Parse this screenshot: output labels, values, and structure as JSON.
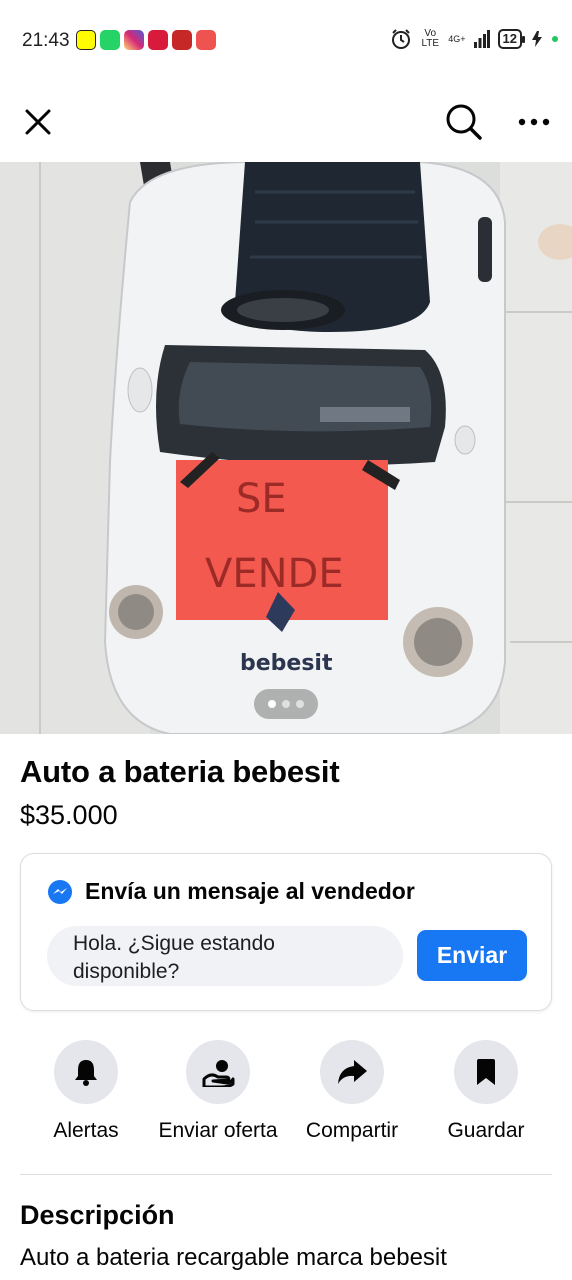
{
  "status_bar": {
    "time": "21:43",
    "notification_icons": [
      "snapchat-icon",
      "whatsapp-icon",
      "instagram-icon",
      "heart-app-icon",
      "shopping-s-icon",
      "gift-app-icon"
    ],
    "volte": "Vo LTE",
    "network": "4G+",
    "battery": "12",
    "accent_colors": {
      "snapchat": "#fffc00",
      "whatsapp": "#25d366",
      "instagram": "#d62976",
      "heart_app": "#d81b3c",
      "shopping": "#c62828",
      "gift_app": "#ef5350"
    }
  },
  "app_bar": {
    "close_icon": "close-icon",
    "search_icon": "search-icon",
    "more_icon": "more-horizontal-icon"
  },
  "photo": {
    "sign_text_line1": "SE",
    "sign_text_line2": "VENDE",
    "brand_badge": "bebesit",
    "carousel": {
      "count": 3,
      "active_index": 0
    }
  },
  "listing": {
    "title": "Auto a bateria bebesit",
    "price": "$35.000"
  },
  "message": {
    "header": "Envía un mensaje al vendedor",
    "input_value": "Hola. ¿Sigue estando disponible?",
    "send_label": "Enviar",
    "accent": "#1877f2"
  },
  "actions": [
    {
      "label": "Alertas",
      "icon": "bell-icon"
    },
    {
      "label": "Enviar oferta",
      "icon": "offer-hand-icon"
    },
    {
      "label": "Compartir",
      "icon": "share-arrow-icon"
    },
    {
      "label": "Guardar",
      "icon": "bookmark-icon"
    }
  ],
  "description": {
    "heading": "Descripción",
    "text": "Auto a bateria recargable marca bebesit"
  }
}
